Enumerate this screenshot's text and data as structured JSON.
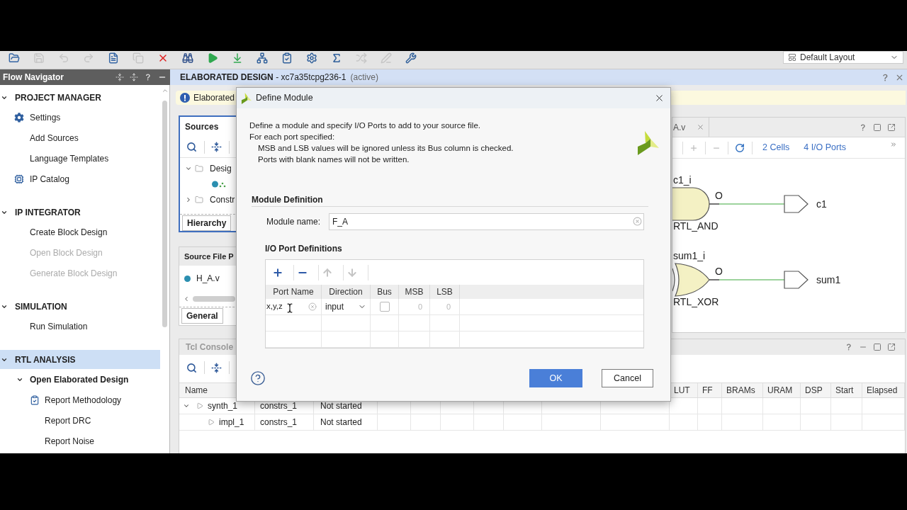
{
  "toolbar": {
    "buttons": [
      {
        "disabled": false
      },
      {
        "disabled": true
      },
      {
        "disabled": true
      },
      {
        "disabled": true
      },
      {
        "disabled": false
      },
      {
        "disabled": true
      },
      {
        "disabled": false
      },
      {
        "disabled": false
      },
      {
        "disabled": false
      },
      {
        "disabled": false
      },
      {
        "disabled": false
      },
      {
        "disabled": false
      },
      {
        "disabled": false
      },
      {
        "disabled": false
      },
      {
        "disabled": true
      },
      {
        "disabled": true
      },
      {
        "disabled": false
      }
    ],
    "layout_select": "Default Layout"
  },
  "flow_navigator": {
    "title": "Flow Navigator",
    "sections": [
      {
        "label": "PROJECT MANAGER",
        "expanded": true,
        "selected": false,
        "items": [
          {
            "label": "Settings",
            "disabled": false
          },
          {
            "label": "Add Sources",
            "disabled": false
          },
          {
            "label": "Language Templates",
            "disabled": false
          },
          {
            "label": "IP Catalog",
            "disabled": false
          }
        ]
      },
      {
        "label": "IP INTEGRATOR",
        "expanded": true,
        "selected": false,
        "items": [
          {
            "label": "Create Block Design",
            "disabled": false
          },
          {
            "label": "Open Block Design",
            "disabled": true
          },
          {
            "label": "Generate Block Design",
            "disabled": true
          }
        ]
      },
      {
        "label": "SIMULATION",
        "expanded": true,
        "selected": false,
        "items": [
          {
            "label": "Run Simulation",
            "disabled": false
          }
        ]
      },
      {
        "label": "RTL ANALYSIS",
        "expanded": true,
        "selected": true,
        "items": [
          {
            "label": "Open Elaborated Design",
            "disabled": false,
            "expanded": true,
            "children": [
              {
                "label": "Report Methodology",
                "disabled": false
              },
              {
                "label": "Report DRC",
                "disabled": false
              },
              {
                "label": "Report Noise",
                "disabled": false
              }
            ]
          }
        ]
      }
    ]
  },
  "design_header": {
    "title": "**ELABORATED DESIGN** - xc7a35tcpg236-1",
    "status": "(active)"
  },
  "banner": {
    "text": "Elaborated"
  },
  "sources": {
    "title": "Sources",
    "tree": [
      {
        "label": "Desig",
        "expanded": true,
        "children": [
          {
            "kind": "module"
          }
        ]
      },
      {
        "label": "Constr",
        "expanded": false
      }
    ],
    "tabs": [
      {
        "label": "Hierarchy",
        "selected": true
      }
    ]
  },
  "source_file_properties": {
    "title": "Source File P",
    "file": "H_A.v",
    "tabs": [
      {
        "label": "General",
        "selected": true
      }
    ]
  },
  "schematic": {
    "tab": "A.v",
    "tools": [
      {
        "disabled": true
      },
      {
        "disabled": true
      },
      {
        "disabled": false
      }
    ],
    "links": [
      "2 Cells",
      "4 I/O Ports"
    ],
    "cells": [
      {
        "kind": "and",
        "name": "c1_i",
        "type": "RTL_AND",
        "pin": "O",
        "port": "c1"
      },
      {
        "kind": "xor",
        "name": "sum1_i",
        "type": "RTL_XOR",
        "pin": "O",
        "port": "sum1"
      }
    ]
  },
  "console": {
    "tabs": [
      {
        "label": "Tcl Console",
        "selected": false
      }
    ],
    "columns": [
      "Name",
      "LUT",
      "FF",
      "BRAMs",
      "URAM",
      "DSP",
      "Start",
      "Elapsed"
    ],
    "rows": [
      {
        "expanded": true,
        "cells": [
          "synth_1",
          "constrs_1",
          "Not started"
        ],
        "children": [
          {
            "cells": [
              "impl_1",
              "constrs_1",
              "Not started"
            ]
          }
        ]
      }
    ]
  },
  "dialog": {
    "title": "Define Module",
    "intro": [
      "Define a module and specify I/O Ports to add to your source file.",
      "For each port specified:"
    ],
    "notes": [
      "MSB and LSB values will be ignored unless its Bus column is checked.",
      "Ports with blank names will not be written."
    ],
    "module_section": "Module Definition",
    "module_name": {
      "label": "Module name:",
      "value": "F_A"
    },
    "ports_section": "I/O Port Definitions",
    "port_tools": [
      {
        "disabled": false
      },
      {
        "disabled": false
      },
      {
        "disabled": true
      },
      {
        "disabled": true
      }
    ],
    "port_columns": [
      "Port Name",
      "Direction",
      "Bus",
      "MSB",
      "LSB"
    ],
    "ports": [
      {
        "name": "x,y,z",
        "direction": "input",
        "bus": false,
        "msb": "0",
        "lsb": "0"
      }
    ],
    "buttons": [
      {
        "label": "OK",
        "kind": "primary"
      },
      {
        "label": "Cancel",
        "kind": "secondary"
      }
    ]
  }
}
